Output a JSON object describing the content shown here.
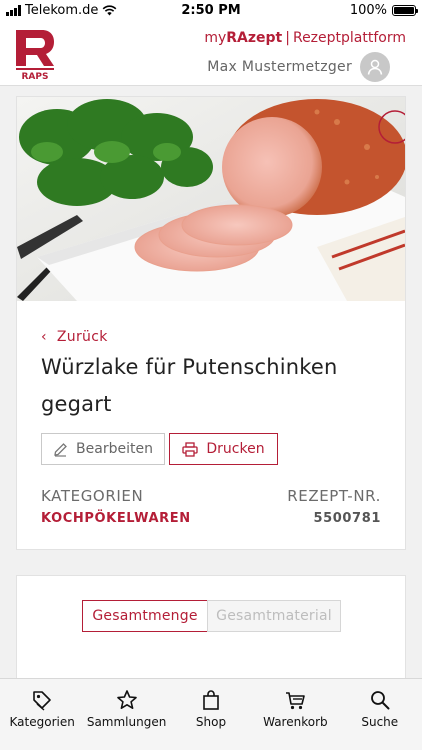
{
  "status": {
    "carrier": "Telekom.de",
    "time": "2:50 PM",
    "battery": "100%"
  },
  "header": {
    "brand": "RAPS",
    "my_prefix": "my",
    "my_brand": "RAzept",
    "separator": "|",
    "platform_link": "Rezeptplattform",
    "user_name": "Max Mustermetzger"
  },
  "recipe": {
    "back_label": "Zurück",
    "title": "Würzlake für Putenschinken gegart",
    "edit_label": "Bearbeiten",
    "print_label": "Drucken",
    "categories_heading": "KATEGORIEN",
    "category": "KOCHPÖKELWAREN",
    "number_heading": "REZEPT-NR.",
    "number": "5500781"
  },
  "amount_tabs": [
    "Gesamtmenge",
    "Gesamtmaterial"
  ],
  "nav": [
    {
      "label": "Kategorien",
      "icon": "tag-icon"
    },
    {
      "label": "Sammlungen",
      "icon": "star-icon"
    },
    {
      "label": "Shop",
      "icon": "bag-icon"
    },
    {
      "label": "Warenkorb",
      "icon": "cart-icon"
    },
    {
      "label": "Suche",
      "icon": "search-icon"
    }
  ],
  "colors": {
    "accent": "#b41e37"
  }
}
